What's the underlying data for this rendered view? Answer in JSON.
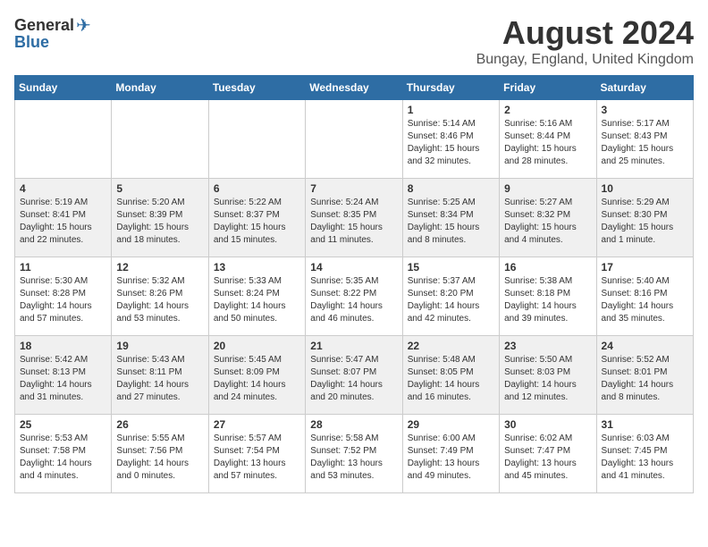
{
  "header": {
    "logo_general": "General",
    "logo_blue": "Blue",
    "month_title": "August 2024",
    "subtitle": "Bungay, England, United Kingdom"
  },
  "days_of_week": [
    "Sunday",
    "Monday",
    "Tuesday",
    "Wednesday",
    "Thursday",
    "Friday",
    "Saturday"
  ],
  "weeks": [
    [
      {
        "day": "",
        "info": ""
      },
      {
        "day": "",
        "info": ""
      },
      {
        "day": "",
        "info": ""
      },
      {
        "day": "",
        "info": ""
      },
      {
        "day": "1",
        "info": "Sunrise: 5:14 AM\nSunset: 8:46 PM\nDaylight: 15 hours\nand 32 minutes."
      },
      {
        "day": "2",
        "info": "Sunrise: 5:16 AM\nSunset: 8:44 PM\nDaylight: 15 hours\nand 28 minutes."
      },
      {
        "day": "3",
        "info": "Sunrise: 5:17 AM\nSunset: 8:43 PM\nDaylight: 15 hours\nand 25 minutes."
      }
    ],
    [
      {
        "day": "4",
        "info": "Sunrise: 5:19 AM\nSunset: 8:41 PM\nDaylight: 15 hours\nand 22 minutes."
      },
      {
        "day": "5",
        "info": "Sunrise: 5:20 AM\nSunset: 8:39 PM\nDaylight: 15 hours\nand 18 minutes."
      },
      {
        "day": "6",
        "info": "Sunrise: 5:22 AM\nSunset: 8:37 PM\nDaylight: 15 hours\nand 15 minutes."
      },
      {
        "day": "7",
        "info": "Sunrise: 5:24 AM\nSunset: 8:35 PM\nDaylight: 15 hours\nand 11 minutes."
      },
      {
        "day": "8",
        "info": "Sunrise: 5:25 AM\nSunset: 8:34 PM\nDaylight: 15 hours\nand 8 minutes."
      },
      {
        "day": "9",
        "info": "Sunrise: 5:27 AM\nSunset: 8:32 PM\nDaylight: 15 hours\nand 4 minutes."
      },
      {
        "day": "10",
        "info": "Sunrise: 5:29 AM\nSunset: 8:30 PM\nDaylight: 15 hours\nand 1 minute."
      }
    ],
    [
      {
        "day": "11",
        "info": "Sunrise: 5:30 AM\nSunset: 8:28 PM\nDaylight: 14 hours\nand 57 minutes."
      },
      {
        "day": "12",
        "info": "Sunrise: 5:32 AM\nSunset: 8:26 PM\nDaylight: 14 hours\nand 53 minutes."
      },
      {
        "day": "13",
        "info": "Sunrise: 5:33 AM\nSunset: 8:24 PM\nDaylight: 14 hours\nand 50 minutes."
      },
      {
        "day": "14",
        "info": "Sunrise: 5:35 AM\nSunset: 8:22 PM\nDaylight: 14 hours\nand 46 minutes."
      },
      {
        "day": "15",
        "info": "Sunrise: 5:37 AM\nSunset: 8:20 PM\nDaylight: 14 hours\nand 42 minutes."
      },
      {
        "day": "16",
        "info": "Sunrise: 5:38 AM\nSunset: 8:18 PM\nDaylight: 14 hours\nand 39 minutes."
      },
      {
        "day": "17",
        "info": "Sunrise: 5:40 AM\nSunset: 8:16 PM\nDaylight: 14 hours\nand 35 minutes."
      }
    ],
    [
      {
        "day": "18",
        "info": "Sunrise: 5:42 AM\nSunset: 8:13 PM\nDaylight: 14 hours\nand 31 minutes."
      },
      {
        "day": "19",
        "info": "Sunrise: 5:43 AM\nSunset: 8:11 PM\nDaylight: 14 hours\nand 27 minutes."
      },
      {
        "day": "20",
        "info": "Sunrise: 5:45 AM\nSunset: 8:09 PM\nDaylight: 14 hours\nand 24 minutes."
      },
      {
        "day": "21",
        "info": "Sunrise: 5:47 AM\nSunset: 8:07 PM\nDaylight: 14 hours\nand 20 minutes."
      },
      {
        "day": "22",
        "info": "Sunrise: 5:48 AM\nSunset: 8:05 PM\nDaylight: 14 hours\nand 16 minutes."
      },
      {
        "day": "23",
        "info": "Sunrise: 5:50 AM\nSunset: 8:03 PM\nDaylight: 14 hours\nand 12 minutes."
      },
      {
        "day": "24",
        "info": "Sunrise: 5:52 AM\nSunset: 8:01 PM\nDaylight: 14 hours\nand 8 minutes."
      }
    ],
    [
      {
        "day": "25",
        "info": "Sunrise: 5:53 AM\nSunset: 7:58 PM\nDaylight: 14 hours\nand 4 minutes."
      },
      {
        "day": "26",
        "info": "Sunrise: 5:55 AM\nSunset: 7:56 PM\nDaylight: 14 hours\nand 0 minutes."
      },
      {
        "day": "27",
        "info": "Sunrise: 5:57 AM\nSunset: 7:54 PM\nDaylight: 13 hours\nand 57 minutes."
      },
      {
        "day": "28",
        "info": "Sunrise: 5:58 AM\nSunset: 7:52 PM\nDaylight: 13 hours\nand 53 minutes."
      },
      {
        "day": "29",
        "info": "Sunrise: 6:00 AM\nSunset: 7:49 PM\nDaylight: 13 hours\nand 49 minutes."
      },
      {
        "day": "30",
        "info": "Sunrise: 6:02 AM\nSunset: 7:47 PM\nDaylight: 13 hours\nand 45 minutes."
      },
      {
        "day": "31",
        "info": "Sunrise: 6:03 AM\nSunset: 7:45 PM\nDaylight: 13 hours\nand 41 minutes."
      }
    ]
  ]
}
